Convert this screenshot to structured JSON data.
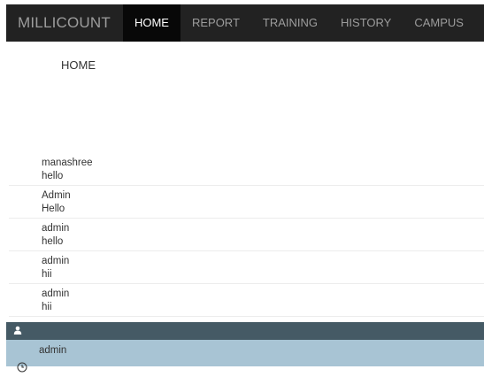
{
  "brand": "MILLICOUNT",
  "nav": {
    "items": [
      {
        "label": "HOME",
        "active": true
      },
      {
        "label": "REPORT",
        "active": false
      },
      {
        "label": "TRAINING",
        "active": false
      },
      {
        "label": "HISTORY",
        "active": false
      },
      {
        "label": "CAMPUS",
        "active": false
      }
    ]
  },
  "main": {
    "heading": "HOME",
    "messages": [
      {
        "user": "manashree",
        "text": "hello"
      },
      {
        "user": "Admin",
        "text": "Hello"
      },
      {
        "user": "admin",
        "text": "hello"
      },
      {
        "user": "admin",
        "text": "hii"
      },
      {
        "user": "admin",
        "text": "hii"
      }
    ]
  },
  "chat": {
    "header_icon": "user-icon",
    "user": "admin",
    "time_icon": "clock-icon"
  },
  "colors": {
    "navbar": "#222222",
    "nav_active": "#080808",
    "chat_header": "#455a65",
    "chat_body": "#a8c4d4"
  }
}
